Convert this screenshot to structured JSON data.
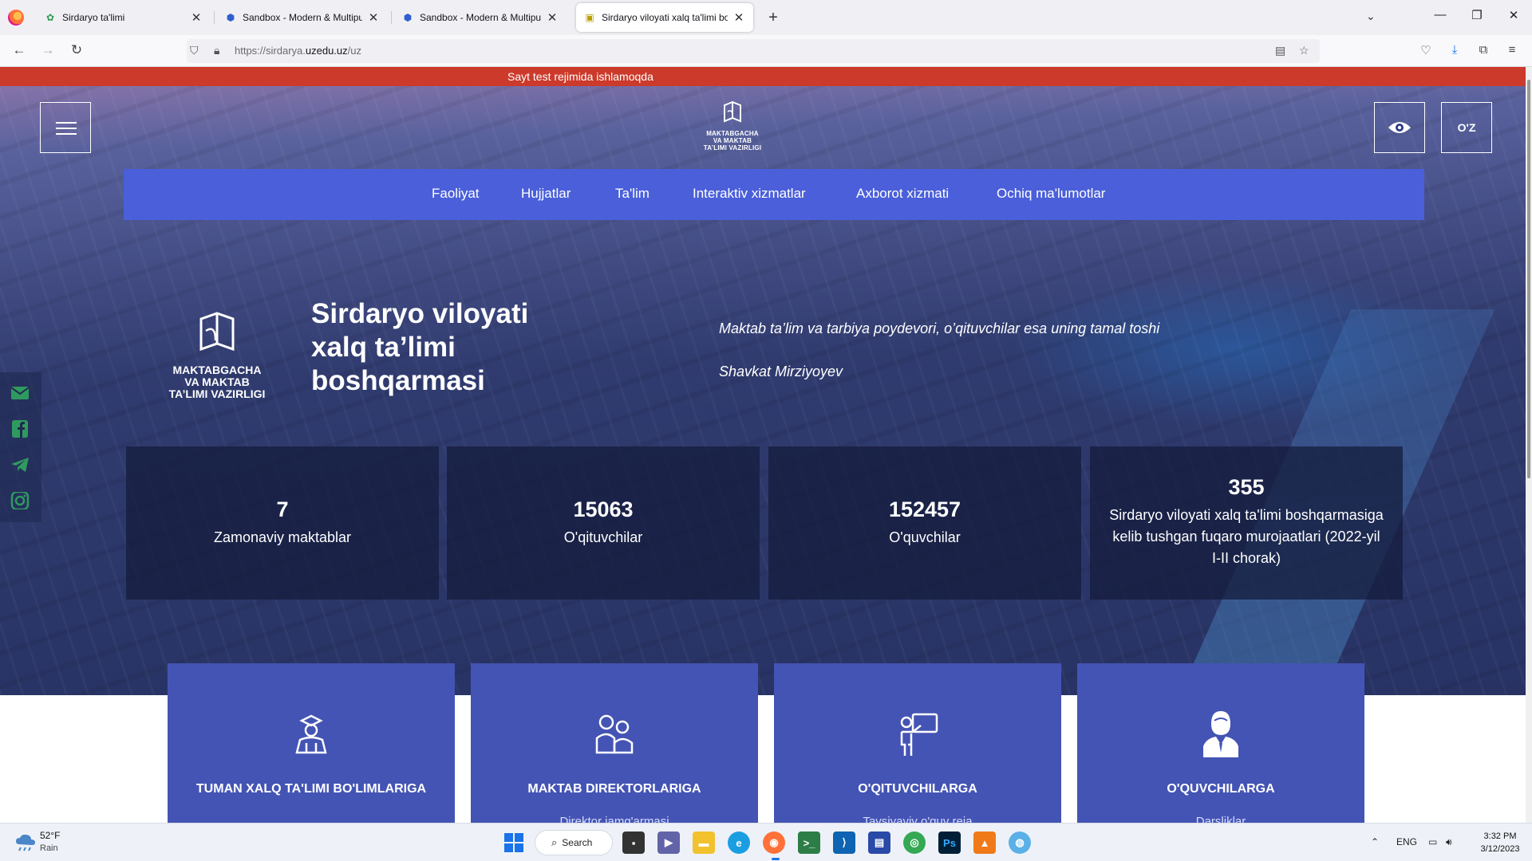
{
  "browser": {
    "tabs": [
      {
        "title": "Sirdaryo ta'limi",
        "active": false
      },
      {
        "title": "Sandbox - Modern & Multipurp",
        "active": false
      },
      {
        "title": "Sandbox - Modern & Multipurp",
        "active": false
      },
      {
        "title": "Sirdaryo viloyati xalq ta'limi bo",
        "active": true
      }
    ],
    "url_prefix": "https://sirdarya.",
    "url_domain": "uzedu.uz",
    "url_path": "/uz"
  },
  "site": {
    "notice": "Sayt test rejimida ishlamoqda",
    "logo_text_lines": [
      "MAKTABGACHA",
      "VA MAKTAB",
      "TA’LIMI VAZIRLIGI"
    ],
    "lang_button": "O'Z",
    "nav": [
      "Faoliyat",
      "Hujjatlar",
      "Ta'lim",
      "Interaktiv xizmatlar",
      "Axborot xizmati",
      "Ochiq ma'lumotlar"
    ],
    "hero_title": "Sirdaryo viloyati xalq ta’limi boshqarmasi",
    "quote": "Maktab ta’lim va tarbiya poydevori, o’qituvchilar esa uning tamal toshi",
    "quote_author": "Shavkat Mirziyoyev",
    "stats": [
      {
        "value": "7",
        "label": "Zamonaviy maktablar"
      },
      {
        "value": "15063",
        "label": "O'qituvchilar"
      },
      {
        "value": "152457",
        "label": "O'quvchilar"
      },
      {
        "value": "355",
        "label": "Sirdaryo viloyati xalq ta'limi boshqarmasiga kelib tushgan fuqaro murojaatlari (2022-yil I-II chorak)"
      }
    ],
    "cards": [
      {
        "title": "TUMAN XALQ TA'LIMI BO'LIMLARIGA",
        "subtitle": "",
        "icon": "students-icon"
      },
      {
        "title": "MAKTAB DIREKTORLARIGA",
        "subtitle": "Direktor jamg'armasi",
        "icon": "parents-icon"
      },
      {
        "title": "O'QITUVCHILARGA",
        "subtitle": "Tavsiyaviy o'quv reja",
        "icon": "teacher-icon"
      },
      {
        "title": "O'QUVCHILARGA",
        "subtitle": "Darsliklar",
        "icon": "student-icon"
      }
    ]
  },
  "taskbar": {
    "weather_temp": "52°F",
    "weather_desc": "Rain",
    "search_label": "Search",
    "lang": "ENG",
    "time": "3:32 PM",
    "date": "3/12/2023"
  }
}
